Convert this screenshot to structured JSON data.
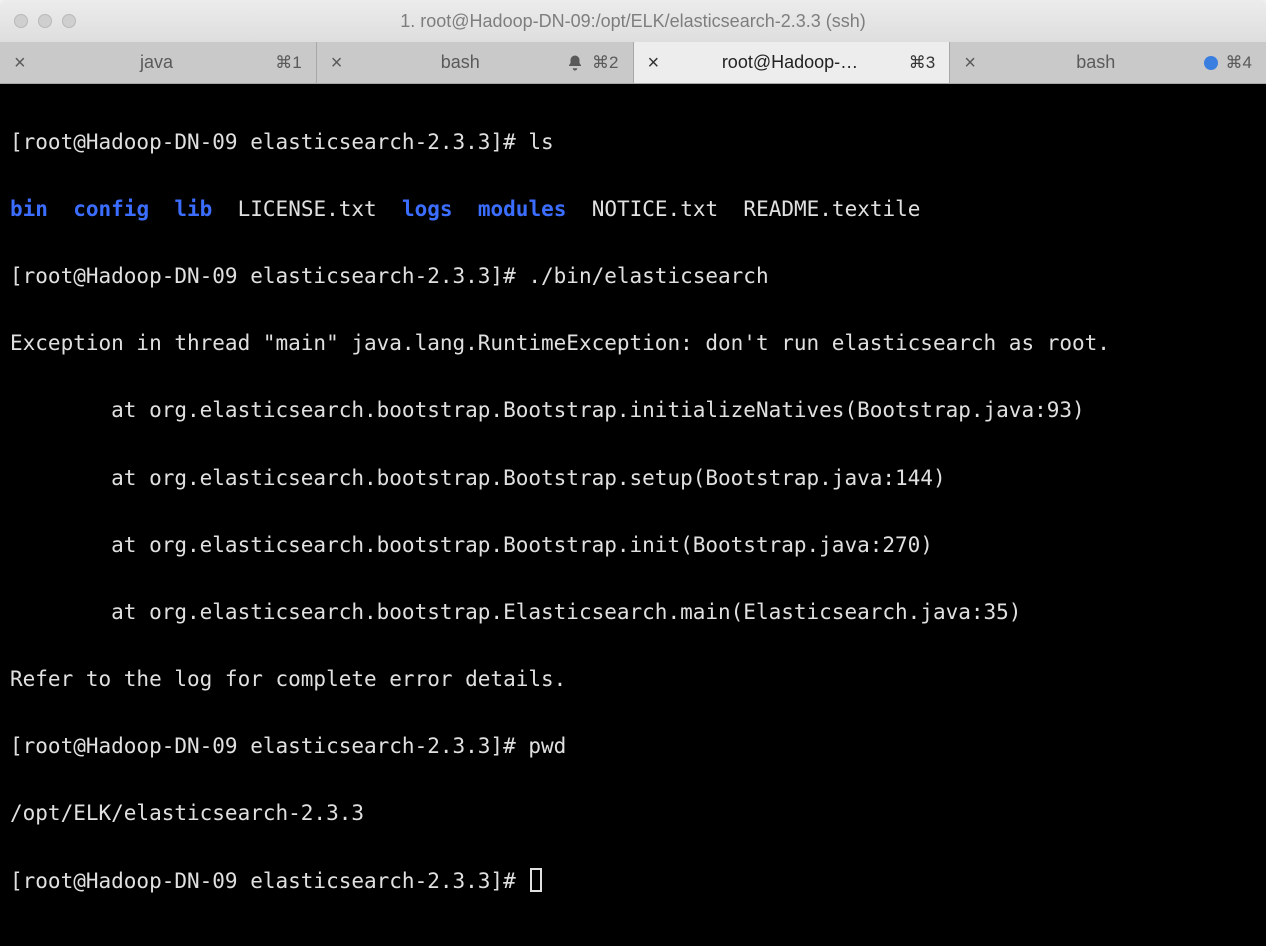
{
  "titlebar": {
    "title": "1. root@Hadoop-DN-09:/opt/ELK/elasticsearch-2.3.3 (ssh)"
  },
  "tabs": [
    {
      "title": "java",
      "shortcut": "⌘1",
      "indicator": "none",
      "active": false
    },
    {
      "title": "bash",
      "shortcut": "⌘2",
      "indicator": "bell",
      "active": false
    },
    {
      "title": "root@Hadoop-…",
      "shortcut": "⌘3",
      "indicator": "none",
      "active": true
    },
    {
      "title": "bash",
      "shortcut": "⌘4",
      "indicator": "dot",
      "active": false
    }
  ],
  "terminal": {
    "prompt1": "[root@Hadoop-DN-09 elasticsearch-2.3.3]# ",
    "cmd_ls": "ls",
    "ls_items": {
      "bin": "bin",
      "config": "config",
      "lib": "lib",
      "license": "LICENSE.txt",
      "logs": "logs",
      "modules": "modules",
      "notice": "NOTICE.txt",
      "readme": "README.textile"
    },
    "cmd_es": "./bin/elasticsearch",
    "err0": "Exception in thread \"main\" java.lang.RuntimeException: don't run elasticsearch as root.",
    "err1": "        at org.elasticsearch.bootstrap.Bootstrap.initializeNatives(Bootstrap.java:93)",
    "err2": "        at org.elasticsearch.bootstrap.Bootstrap.setup(Bootstrap.java:144)",
    "err3": "        at org.elasticsearch.bootstrap.Bootstrap.init(Bootstrap.java:270)",
    "err4": "        at org.elasticsearch.bootstrap.Elasticsearch.main(Elasticsearch.java:35)",
    "err5": "Refer to the log for complete error details.",
    "cmd_pwd": "pwd",
    "pwd_out": "/opt/ELK/elasticsearch-2.3.3"
  }
}
